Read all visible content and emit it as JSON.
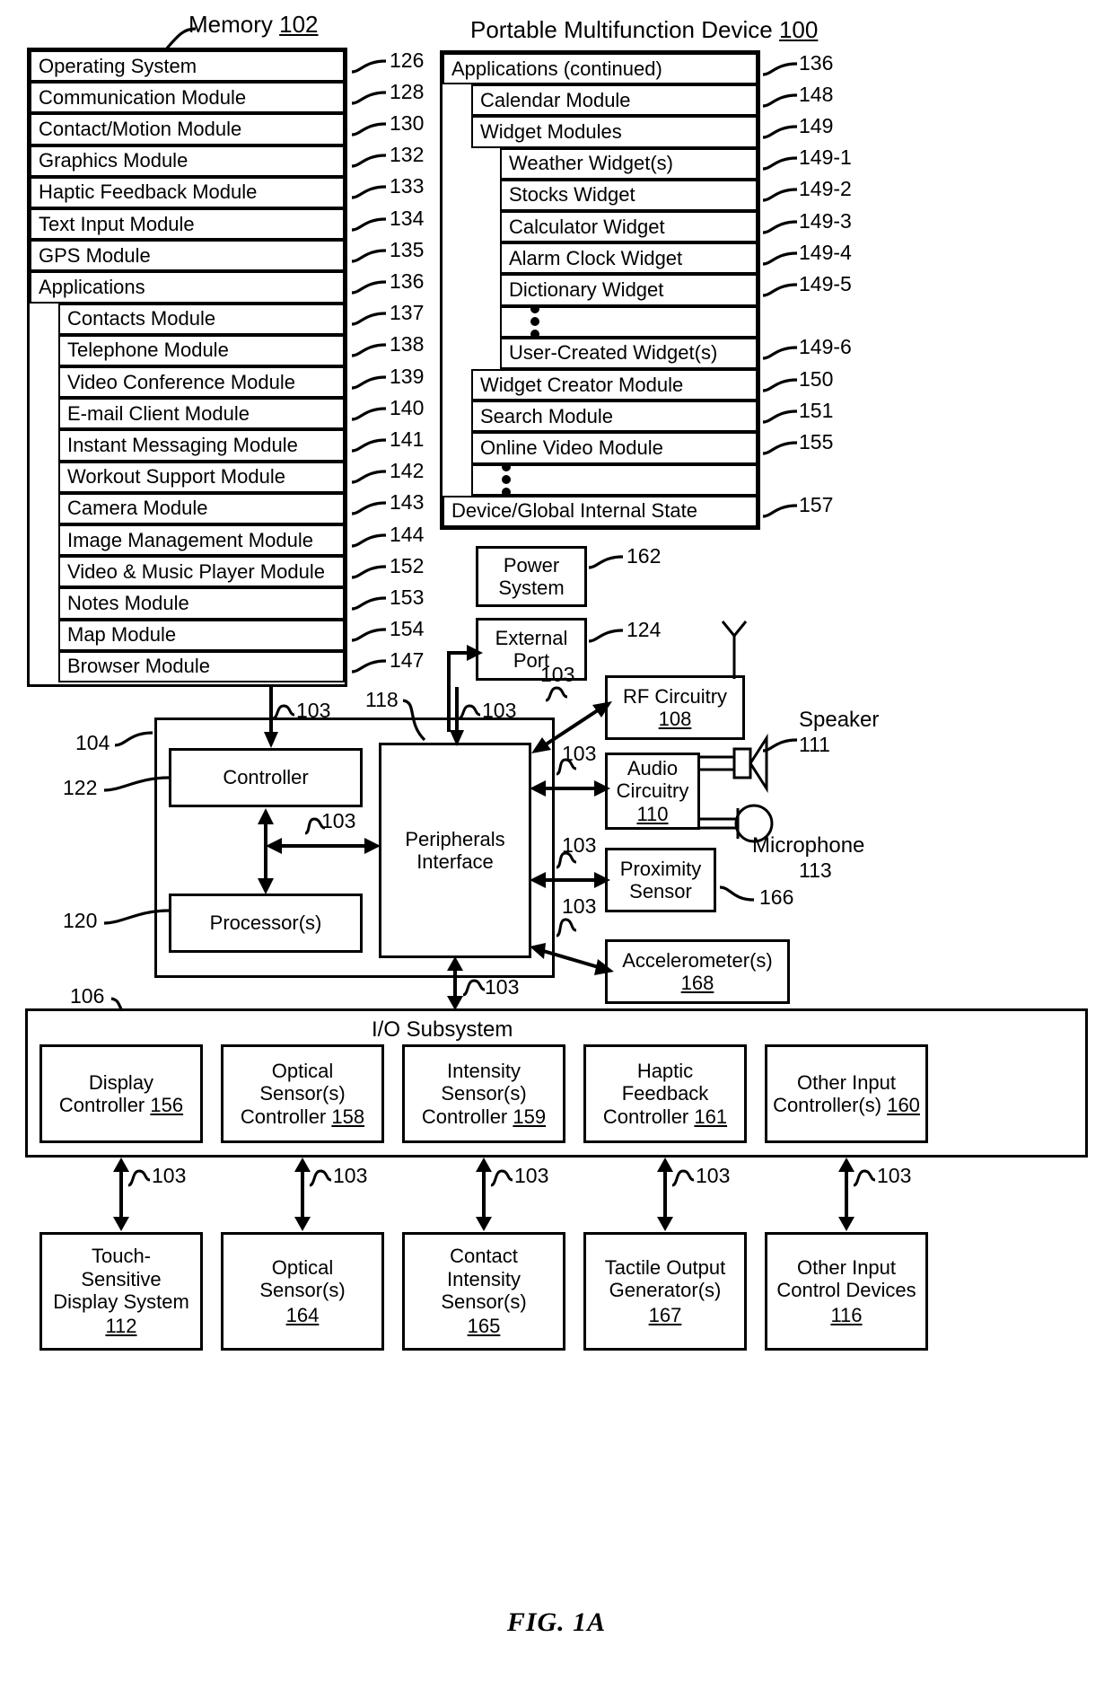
{
  "figure": {
    "caption": "FIG. 1A",
    "memory_title": "Memory",
    "memory_ref": "102",
    "device_title": "Portable Multifunction Device",
    "device_ref": "100"
  },
  "memory_column": {
    "items": [
      {
        "label": "Operating System",
        "ref": "126",
        "indent": 0
      },
      {
        "label": "Communication Module",
        "ref": "128",
        "indent": 0
      },
      {
        "label": "Contact/Motion Module",
        "ref": "130",
        "indent": 0
      },
      {
        "label": "Graphics Module",
        "ref": "132",
        "indent": 0
      },
      {
        "label": "Haptic Feedback Module",
        "ref": "133",
        "indent": 0
      },
      {
        "label": "Text Input Module",
        "ref": "134",
        "indent": 0
      },
      {
        "label": "GPS Module",
        "ref": "135",
        "indent": 0
      },
      {
        "label": "Applications",
        "ref": "136",
        "indent": 0
      },
      {
        "label": "Contacts Module",
        "ref": "137",
        "indent": 1
      },
      {
        "label": "Telephone Module",
        "ref": "138",
        "indent": 1
      },
      {
        "label": "Video Conference Module",
        "ref": "139",
        "indent": 1
      },
      {
        "label": "E-mail Client Module",
        "ref": "140",
        "indent": 1
      },
      {
        "label": "Instant Messaging Module",
        "ref": "141",
        "indent": 1
      },
      {
        "label": "Workout Support Module",
        "ref": "142",
        "indent": 1
      },
      {
        "label": "Camera Module",
        "ref": "143",
        "indent": 1
      },
      {
        "label": "Image Management Module",
        "ref": "144",
        "indent": 1
      },
      {
        "label": "Video & Music Player Module",
        "ref": "152",
        "indent": 1
      },
      {
        "label": "Notes Module",
        "ref": "153",
        "indent": 1
      },
      {
        "label": "Map Module",
        "ref": "154",
        "indent": 1
      },
      {
        "label": "Browser Module",
        "ref": "147",
        "indent": 1
      }
    ]
  },
  "device_column": {
    "items": [
      {
        "label": "Applications (continued)",
        "ref": "136",
        "indent": 0
      },
      {
        "label": "Calendar Module",
        "ref": "148",
        "indent": 1
      },
      {
        "label": "Widget Modules",
        "ref": "149",
        "indent": 1
      },
      {
        "label": "Weather Widget(s)",
        "ref": "149-1",
        "indent": 2
      },
      {
        "label": "Stocks Widget",
        "ref": "149-2",
        "indent": 2
      },
      {
        "label": "Calculator Widget",
        "ref": "149-3",
        "indent": 2
      },
      {
        "label": "Alarm Clock Widget",
        "ref": "149-4",
        "indent": 2
      },
      {
        "label": "Dictionary Widget",
        "ref": "149-5",
        "indent": 2
      },
      {
        "label": "",
        "ref": "",
        "indent": 2,
        "dots": true
      },
      {
        "label": "User-Created Widget(s)",
        "ref": "149-6",
        "indent": 2
      },
      {
        "label": "Widget Creator Module",
        "ref": "150",
        "indent": 1
      },
      {
        "label": "Search Module",
        "ref": "151",
        "indent": 1
      },
      {
        "label": "Online Video Module",
        "ref": "155",
        "indent": 1
      },
      {
        "label": "",
        "ref": "",
        "indent": 1,
        "dots": true
      },
      {
        "label": "Device/Global Internal State",
        "ref": "157",
        "indent": 0
      }
    ]
  },
  "hardware": {
    "power_system": {
      "line1": "Power",
      "line2": "System",
      "ref": "162"
    },
    "external_port": {
      "line1": "External",
      "line2": "Port",
      "ref": "124"
    },
    "rf_circuitry": {
      "line1": "RF Circuitry",
      "num": "108"
    },
    "audio_circuitry": {
      "line1": "Audio",
      "line2": "Circuitry",
      "num": "110"
    },
    "speaker": {
      "label": "Speaker",
      "ref": "111"
    },
    "microphone": {
      "label": "Microphone",
      "ref": "113"
    },
    "proximity_sensor": {
      "line1": "Proximity",
      "line2": "Sensor",
      "ref": "166"
    },
    "accelerometer": {
      "line1": "Accelerometer(s)",
      "num": "168"
    },
    "controller": {
      "label": "Controller",
      "ref_a": "104",
      "ref_b": "122"
    },
    "processor": {
      "label": "Processor(s)",
      "ref": "120"
    },
    "peripherals_interface": {
      "line1": "Peripherals",
      "line2": "Interface",
      "ref": "118"
    },
    "bus_ref": "103"
  },
  "io_subsystem": {
    "title": "I/O Subsystem",
    "ref": "106",
    "controllers": [
      {
        "line1": "Display",
        "line2": "Controller",
        "num": "156"
      },
      {
        "line1": "Optical",
        "line2": "Sensor(s)",
        "line3": "Controller",
        "num": "158"
      },
      {
        "line1": "Intensity",
        "line2": "Sensor(s)",
        "line3": "Controller",
        "num": "159"
      },
      {
        "line1": "Haptic",
        "line2": "Feedback",
        "line3": "Controller",
        "num": "161"
      },
      {
        "line1": "Other Input",
        "line2": "Controller(s)",
        "num": "160"
      }
    ],
    "devices": [
      {
        "line1": "Touch-",
        "line2": "Sensitive",
        "line3": "Display System",
        "num": "112"
      },
      {
        "line1": "Optical",
        "line2": "Sensor(s)",
        "num": "164"
      },
      {
        "line1": "Contact",
        "line2": "Intensity",
        "line3": "Sensor(s)",
        "num": "165"
      },
      {
        "line1": "Tactile Output",
        "line2": "Generator(s)",
        "num": "167"
      },
      {
        "line1": "Other Input",
        "line2": "Control Devices",
        "num": "116"
      }
    ],
    "link_ref": "103"
  }
}
